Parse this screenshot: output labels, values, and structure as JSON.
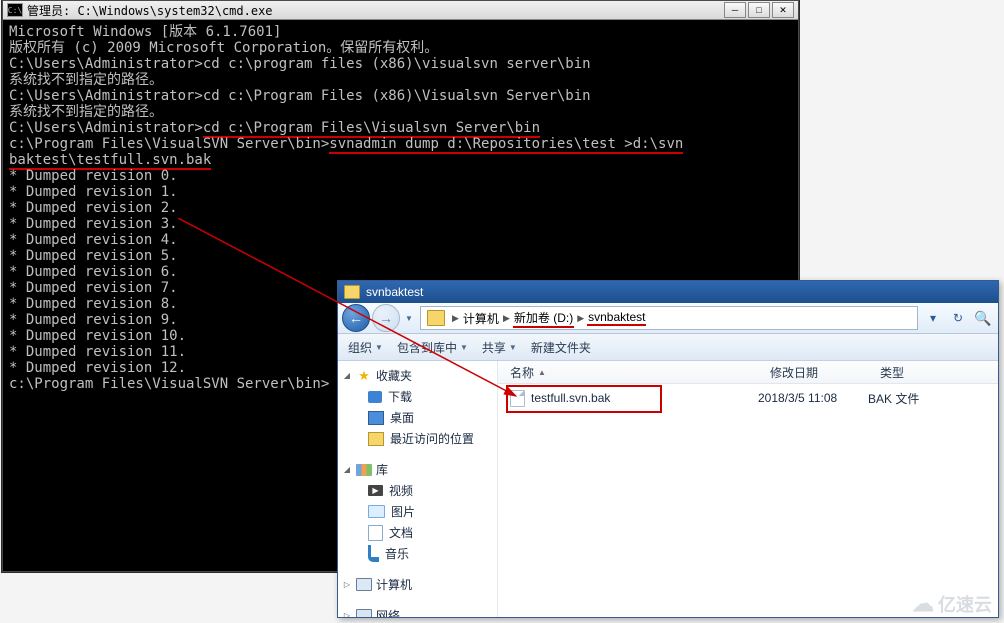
{
  "cmd": {
    "title": "管理员: C:\\Windows\\system32\\cmd.exe",
    "lines": {
      "l0": "Microsoft Windows [版本 6.1.7601]",
      "l1": "版权所有 (c) 2009 Microsoft Corporation。保留所有权利。",
      "blank": "",
      "p1": "C:\\Users\\Administrator>",
      "c1": "cd c:\\program files (x86)\\visualsvn server\\bin",
      "e1": "系统找不到指定的路径。",
      "p2": "C:\\Users\\Administrator>",
      "c2": "cd c:\\Program Files (x86)\\Visualsvn Server\\bin",
      "e2": "系统找不到指定的路径。",
      "p3": "C:\\Users\\Administrator>",
      "c3": "cd c:\\Program Files\\Visualsvn Server\\bin",
      "p4": "c:\\Program Files\\VisualSVN Server\\bin>",
      "c4a": "svnadmin dump d:\\Repositories\\test >d:\\svn",
      "c4b": "baktest\\testfull.svn.bak",
      "d0": "* Dumped revision 0.",
      "d1": "* Dumped revision 1.",
      "d2": "* Dumped revision 2.",
      "d3": "* Dumped revision 3.",
      "d4": "* Dumped revision 4.",
      "d5": "* Dumped revision 5.",
      "d6": "* Dumped revision 6.",
      "d7": "* Dumped revision 7.",
      "d8": "* Dumped revision 8.",
      "d9": "* Dumped revision 9.",
      "d10": "* Dumped revision 10.",
      "d11": "* Dumped revision 11.",
      "d12": "* Dumped revision 12.",
      "p5": "c:\\Program Files\\VisualSVN Server\\bin>"
    },
    "sys_icon": "C:\\"
  },
  "explorer": {
    "title": "svnbaktest",
    "breadcrumb": {
      "seg1": "计算机",
      "seg2": "新加卷 (D:)",
      "seg3": "svnbaktest"
    },
    "toolbar": {
      "organize": "组织",
      "include": "包含到库中",
      "share": "共享",
      "newfolder": "新建文件夹"
    },
    "sidebar": {
      "fav": "收藏夹",
      "downloads": "下载",
      "desktop": "桌面",
      "recent": "最近访问的位置",
      "lib": "库",
      "videos": "视频",
      "pictures": "图片",
      "docs": "文档",
      "music": "音乐",
      "computer": "计算机",
      "network": "网络"
    },
    "columns": {
      "name": "名称",
      "date": "修改日期",
      "type": "类型"
    },
    "file": {
      "name": "testfull.svn.bak",
      "date": "2018/3/5 11:08",
      "type": "BAK 文件"
    }
  },
  "watermark": {
    "text": "亿速云"
  }
}
